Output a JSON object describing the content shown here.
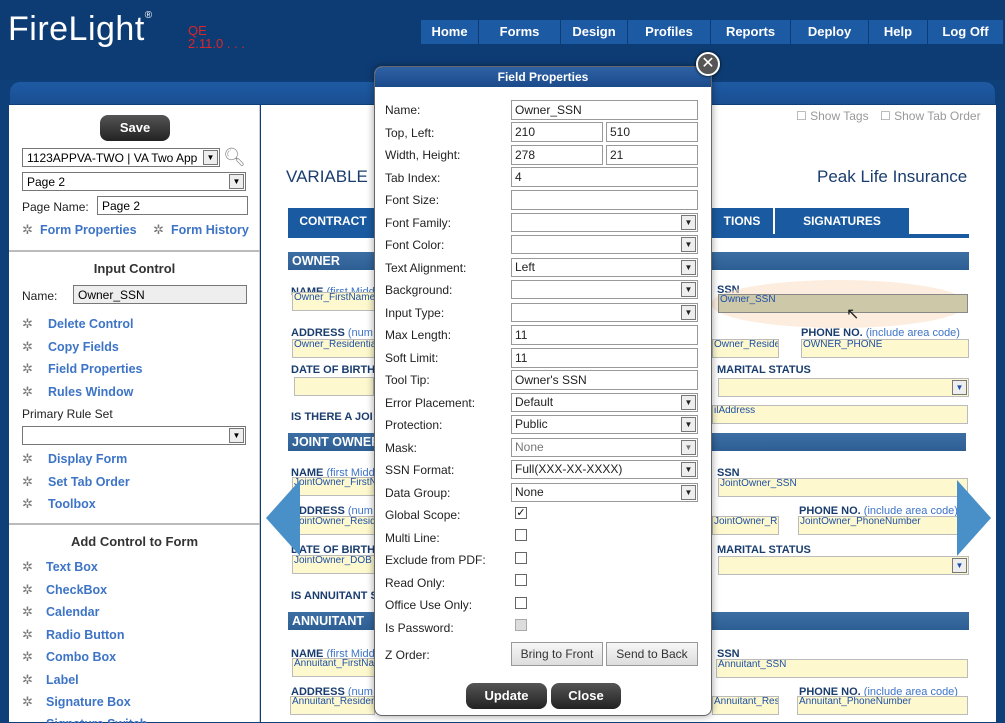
{
  "app": {
    "logo": "FireLight",
    "reg": "®",
    "env_line1": "QE",
    "env_line2": "2.11.0 . . ."
  },
  "nav": [
    "Home",
    "Forms",
    "Design",
    "Profiles",
    "Reports",
    "Deploy",
    "Help",
    "Log Off"
  ],
  "left": {
    "save": "Save",
    "form_select": "1123APPVA-TWO | VA Two App",
    "page_select": "Page 2",
    "page_name_label": "Page Name:",
    "page_name_value": "Page 2",
    "form_properties": "Form Properties",
    "form_history": "Form History",
    "input_control_title": "Input Control",
    "name_label": "Name:",
    "name_value": "Owner_SSN",
    "links1": [
      "Delete Control",
      "Copy Fields",
      "Field Properties",
      "Rules Window"
    ],
    "primary_rule_set": "Primary Rule Set",
    "links2": [
      "Display Form",
      "Set Tab Order",
      "Toolbox"
    ],
    "add_control_title": "Add Control to Form",
    "controls": [
      "Text Box",
      "CheckBox",
      "Calendar",
      "Radio Button",
      "Combo Box",
      "Label",
      "Signature Box",
      "Signature Switch"
    ]
  },
  "right": {
    "show_tags": "Show Tags",
    "show_tab_order": "Show Tab Order",
    "form_title": "VARIABLE",
    "company": "Peak Life Insurance",
    "tabs": [
      "CONTRACT",
      "TIONS",
      "SIGNATURES"
    ],
    "sections": [
      "OWNER",
      "JOINT OWNER",
      "ANNUITANT"
    ],
    "owner": {
      "name_label": "NAME",
      "name_hint": "(first Midd",
      "name_field": "Owner_FirstName",
      "ssn_label": "SSN",
      "ssn_field": "Owner_SSN",
      "address_label": "ADDRESS",
      "address_hint": "(num",
      "address_field": "Owner_Residentia",
      "address_field2": "Owner_Reside",
      "phone_label": "PHONE NO.",
      "phone_hint": "(include area code)",
      "phone_field": "OWNER_PHONE",
      "dob_label": "DATE OF BIRTH",
      "marital_label": "MARITAL STATUS",
      "is_there": "IS THERE A JOI",
      "email_field": "ilAddress"
    },
    "joint": {
      "name_label": "NAME",
      "name_hint": "(first Midd",
      "name_field": "JointOwner_FirstN",
      "ssn_label": "SSN",
      "ssn_field": "JointOwner_SSN",
      "address_label": "ADDRESS",
      "address_hint": "(num",
      "address_field": "JointOwner_Resid",
      "address_field2": "JointOwner_R",
      "phone_label": "PHONE NO.",
      "phone_hint": "(include area code)",
      "phone_field": "JointOwner_PhoneNumber",
      "dob_label": "DATE OF BIRTH",
      "dob_field": "JointOwner_DOB",
      "marital_label": "MARITAL STATUS",
      "is_annuitant": "IS ANNUITANT S"
    },
    "annuitant": {
      "name_label": "NAME",
      "name_hint": "(first Midd",
      "name_field": "Annuitant_FirstNa",
      "ssn_label": "SSN",
      "ssn_field": "Annuitant_SSN",
      "address_label": "ADDRESS",
      "address_hint": "(num",
      "address_field": "Annuitant_Residen",
      "address_field2": "Annuitant_Res",
      "phone_label": "PHONE NO.",
      "phone_hint": "(include area code)",
      "phone_field": "Annuitant_PhoneNumber"
    }
  },
  "modal": {
    "title": "Field Properties",
    "name_label": "Name:",
    "name": "Owner_SSN",
    "topleft_label": "Top, Left:",
    "top": "210",
    "left": "510",
    "wh_label": "Width, Height:",
    "width": "278",
    "height": "21",
    "tabindex_label": "Tab Index:",
    "tabindex": "4",
    "fontsize_label": "Font Size:",
    "fontsize": "",
    "fontfamily_label": "Font Family:",
    "fontfamily": "",
    "fontcolor_label": "Font Color:",
    "fontcolor": "",
    "textalign_label": "Text Alignment:",
    "textalign": "Left",
    "background_label": "Background:",
    "background": "",
    "inputtype_label": "Input Type:",
    "inputtype": "",
    "maxlength_label": "Max Length:",
    "maxlength": "11",
    "softlimit_label": "Soft Limit:",
    "softlimit": "11",
    "tooltip_label": "Tool Tip:",
    "tooltip": "Owner's SSN",
    "errorplacement_label": "Error Placement:",
    "errorplacement": "Default",
    "protection_label": "Protection:",
    "protection": "Public",
    "mask_label": "Mask:",
    "mask": "None",
    "ssnformat_label": "SSN Format:",
    "ssnformat": "Full(XXX-XX-XXXX)",
    "datagroup_label": "Data Group:",
    "datagroup": "None",
    "globalscope_label": "Global Scope:",
    "globalscope": true,
    "multiline_label": "Multi Line:",
    "excludepdf_label": "Exclude from PDF:",
    "readonly_label": "Read Only:",
    "officeuse_label": "Office Use Only:",
    "ispassword_label": "Is Password:",
    "zorder_label": "Z Order:",
    "bring_front": "Bring to Front",
    "send_back": "Send to Back",
    "update": "Update",
    "close": "Close",
    "close_icon": "✕"
  },
  "colors": {
    "header": "#0d3c74",
    "nav": "#1c5aa3",
    "field": "#fdf8cd",
    "link": "#3d74c6"
  }
}
